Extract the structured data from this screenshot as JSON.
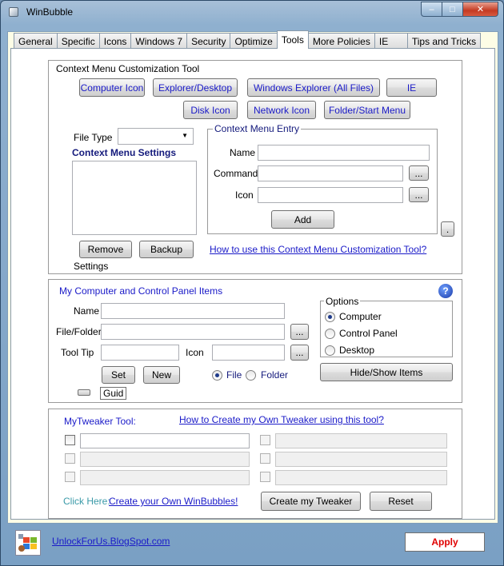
{
  "window": {
    "title": "WinBubble",
    "minimize": "–",
    "maximize": "□",
    "close": "✕"
  },
  "tabs": [
    {
      "label": "General"
    },
    {
      "label": "Specific"
    },
    {
      "label": "Icons"
    },
    {
      "label": "Windows 7"
    },
    {
      "label": "Security"
    },
    {
      "label": "Optimize"
    },
    {
      "label": "Tools"
    },
    {
      "label": "More Policies"
    },
    {
      "label": "IE"
    },
    {
      "label": "Tips and Tricks"
    }
  ],
  "active_tab": "Tools",
  "context_menu": {
    "title": "Context Menu Customization Tool",
    "buttons": {
      "computer_icon": "Computer Icon",
      "explorer_desktop": "Explorer/Desktop",
      "windows_explorer": "Windows Explorer (All Files)",
      "ie": "IE",
      "disk_icon": "Disk Icon",
      "network_icon": "Network Icon",
      "folder_start_menu": "Folder/Start Menu"
    },
    "file_type_label": "File Type",
    "file_type_value": "",
    "settings_heading": "Context Menu Settings",
    "remove": "Remove",
    "backup": "Backup",
    "settings_caption": "Settings",
    "entry": {
      "title": "Context Menu Entry",
      "name_label": "Name",
      "command_label": "Command",
      "icon_label": "Icon",
      "browse": "...",
      "add": "Add"
    },
    "dot_button": ".",
    "help_link": "How to use this Context Menu Customization Tool?"
  },
  "computer_panel": {
    "title": "My Computer and Control Panel Items",
    "help_glyph": "?",
    "name_label": "Name",
    "file_folder_label": "File/Folder",
    "tooltip_label": "Tool Tip",
    "icon_label": "Icon",
    "browse": "...",
    "set": "Set",
    "new": "New",
    "file_radio": "File",
    "folder_radio": "Folder",
    "guid": "Guid",
    "options": {
      "title": "Options",
      "computer": "Computer",
      "control_panel": "Control Panel",
      "desktop": "Desktop"
    },
    "hide_show": "Hide/Show Items"
  },
  "tweaker": {
    "title": "MyTweaker Tool:",
    "howto_link": "How to Create my Own Tweaker using this tool?",
    "click_here": "Click Here:",
    "create_link": "Create your Own WinBubbles!",
    "create_button": "Create my Tweaker",
    "reset_button": "Reset"
  },
  "footer": {
    "site_link": "UnlockForUs.BlogSpot.com",
    "apply": "Apply"
  },
  "colors": {
    "accent_blue": "#1a1ac8",
    "apply_red": "#e00000"
  }
}
